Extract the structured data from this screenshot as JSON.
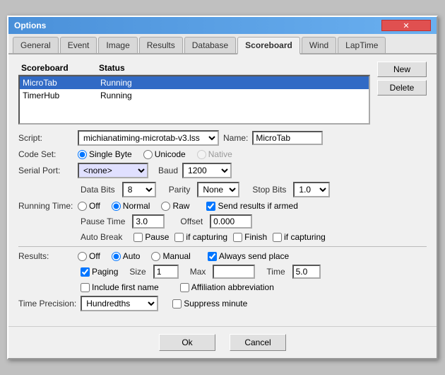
{
  "window": {
    "title": "Options",
    "close_icon": "✕"
  },
  "tabs": [
    {
      "id": "general",
      "label": "General"
    },
    {
      "id": "event",
      "label": "Event"
    },
    {
      "id": "image",
      "label": "Image"
    },
    {
      "id": "results",
      "label": "Results"
    },
    {
      "id": "database",
      "label": "Database"
    },
    {
      "id": "scoreboard",
      "label": "Scoreboard",
      "active": true
    },
    {
      "id": "wind",
      "label": "Wind"
    },
    {
      "id": "laptime",
      "label": "LapTime"
    }
  ],
  "scoreboard_section": {
    "col1_header": "Scoreboard",
    "col2_header": "Status",
    "items": [
      {
        "name": "MicroTab",
        "status": "Running",
        "selected": true
      },
      {
        "name": "TimerHub",
        "status": "Running",
        "selected": false
      }
    ],
    "btn_new": "New",
    "btn_delete": "Delete"
  },
  "script_row": {
    "label": "Script:",
    "value": "michianatiming-microtab-v3.lss",
    "name_label": "Name:",
    "name_value": "MicroTab"
  },
  "codeset_row": {
    "label": "Code Set:",
    "options": [
      "Single Byte",
      "Unicode",
      "Native"
    ],
    "selected": "Single Byte"
  },
  "serial_row": {
    "label": "Serial Port:",
    "port_value": "<none>",
    "baud_label": "Baud",
    "baud_value": "1200"
  },
  "bits_row": {
    "data_bits_label": "Data Bits",
    "data_bits_value": "8",
    "parity_label": "Parity",
    "parity_value": "None",
    "stop_bits_label": "Stop Bits",
    "stop_bits_value": "1.0"
  },
  "running_time": {
    "label": "Running Time:",
    "options": [
      "Off",
      "Normal",
      "Raw"
    ],
    "selected": "Normal",
    "check_label": "Send results if armed"
  },
  "pause_offset": {
    "pause_label": "Pause Time",
    "pause_value": "3.0",
    "offset_label": "Offset",
    "offset_value": "0.000"
  },
  "auto_break": {
    "label": "Auto Break",
    "items": [
      "Pause",
      "if capturing",
      "Finish",
      "if capturing"
    ]
  },
  "results": {
    "label": "Results:",
    "options": [
      "Off",
      "Auto",
      "Manual"
    ],
    "selected": "Auto",
    "always_send_label": "Always send place",
    "paging_label": "Paging",
    "size_label": "Size",
    "size_value": "1",
    "max_label": "Max",
    "max_value": "",
    "time_label": "Time",
    "time_value": "5.0",
    "include_first_name": "Include first name",
    "affiliation_label": "Affiliation abbreviation"
  },
  "time_precision": {
    "label": "Time Precision:",
    "value": "Hundredths",
    "suppress_label": "Suppress minute"
  },
  "buttons": {
    "ok": "Ok",
    "cancel": "Cancel"
  }
}
